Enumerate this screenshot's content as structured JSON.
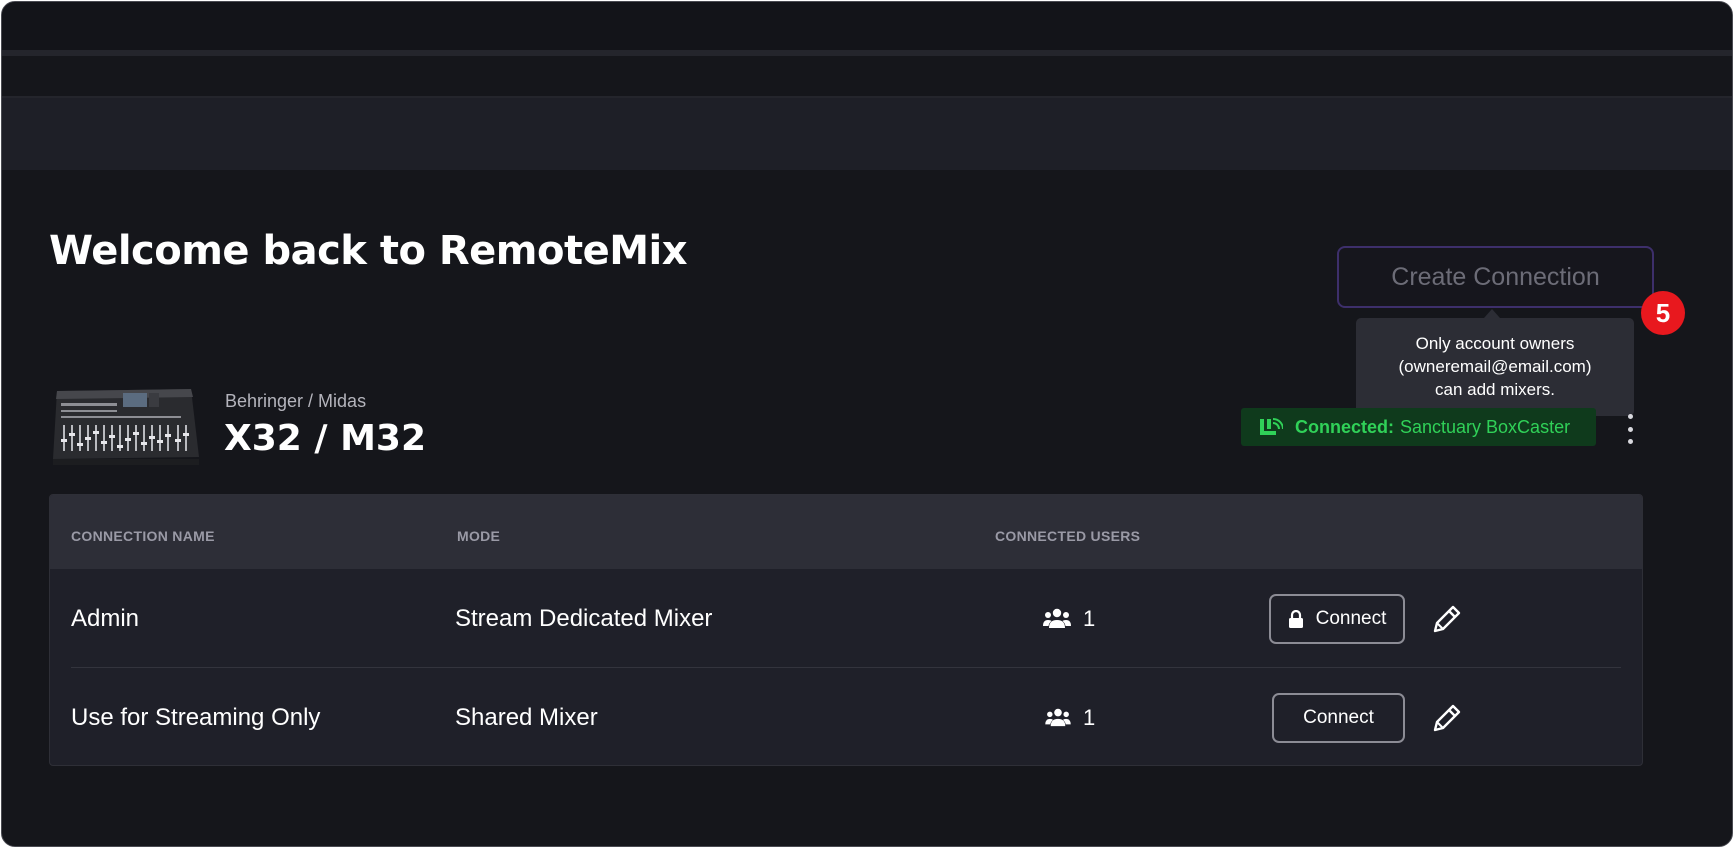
{
  "page": {
    "title": "Welcome back to RemoteMix"
  },
  "create_button": {
    "label": "Create Connection"
  },
  "step_badge": "5",
  "tooltip": {
    "line1": "Only account owners",
    "line2": "(owneremail@email.com)",
    "line3": "can add mixers."
  },
  "mixer": {
    "brand": "Behringer / Midas",
    "model": "X32 / M32",
    "status_label": "Connected:",
    "status_value": "Sanctuary BoxCaster",
    "status_color": "#30d158"
  },
  "table": {
    "headers": [
      "CONNECTION NAME",
      "MODE",
      "CONNECTED USERS"
    ],
    "rows": [
      {
        "name": "Admin",
        "mode": "Stream Dedicated Mixer",
        "users": "1",
        "button": "Connect",
        "locked": true
      },
      {
        "name": "Use for Streaming Only",
        "mode": "Shared Mixer",
        "users": "1",
        "button": "Connect",
        "locked": false
      }
    ]
  },
  "colors": {
    "accent_border": "#3d2f6b",
    "badge": "#e8181e",
    "background": "#15161b"
  },
  "icons": [
    "mixer-console-image",
    "broadcast-icon",
    "kebab-menu-icon",
    "users-icon",
    "lock-icon",
    "pencil-icon"
  ]
}
